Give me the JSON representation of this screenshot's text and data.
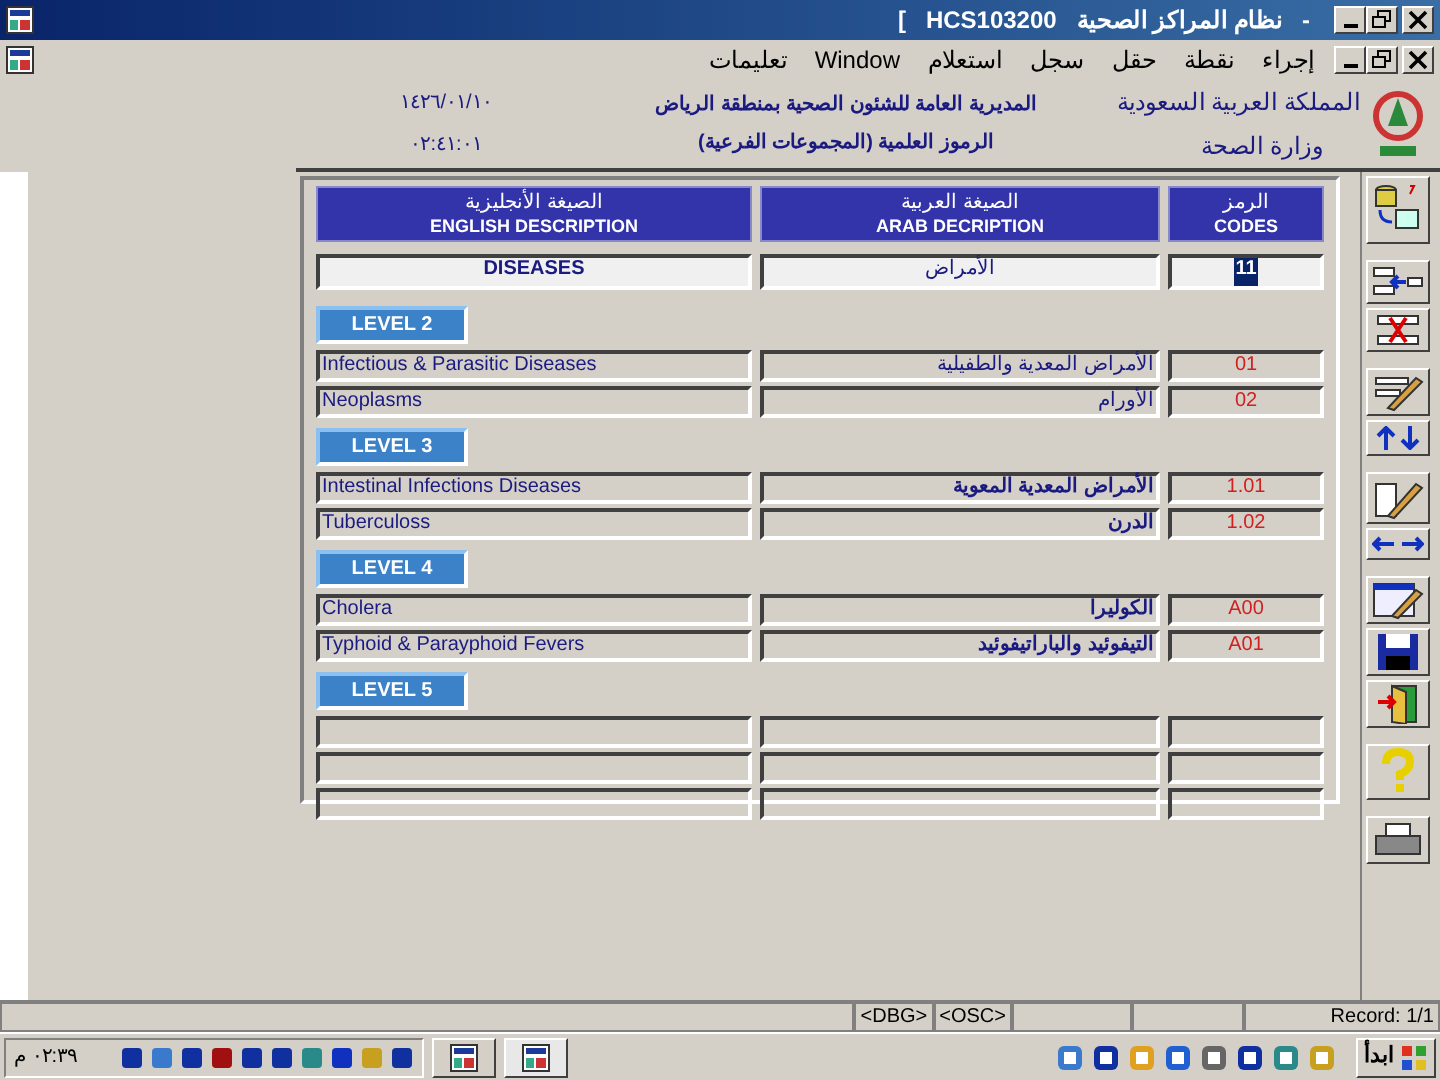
{
  "window": {
    "title_parts": [
      "-",
      "نظام المراكز الصحية",
      "HCS103200",
      "["
    ]
  },
  "menu": [
    "إجراء",
    "نقطة",
    "حقل",
    "سجل",
    "استعلام",
    "Window",
    "تعليمات"
  ],
  "header": {
    "country": "المملكة العربية السعودية",
    "ministry": "وزارة الصحة",
    "directorate": "المديرية العامة للشئون الصحية بمنطقة الرياض",
    "screen_title": "الرموز العلمية (المجموعات الفرعية)",
    "date": "١٤٢٦/٠١/١٠",
    "time": "٠٢:٤١:٠١"
  },
  "table": {
    "columns": [
      {
        "arabic": "الرمز",
        "english": "CODES"
      },
      {
        "arabic": "الصيغة العربية",
        "english": "ARAB DECRIPTION"
      },
      {
        "arabic": "الصيغة الأنجليزية",
        "english": "ENGLISH DESCRIPTION"
      }
    ],
    "top_row": {
      "code": "11",
      "selected": true,
      "arabic": "الأمراض",
      "english": "DISEASES"
    },
    "levels": [
      {
        "label": "LEVEL 2",
        "rows": [
          {
            "kind": "data",
            "code": "01",
            "arabic": "الأمراض المعدية والطفيلية",
            "bold": false,
            "english": "Infectious & Parasitic Diseases"
          },
          {
            "kind": "data",
            "code": "02",
            "arabic": "الأورام",
            "bold": false,
            "english": "Neoplasms"
          }
        ]
      },
      {
        "label": "LEVEL 3",
        "rows": [
          {
            "kind": "data",
            "code": "1.01",
            "arabic": "الأمراض المعدية المعوية",
            "bold": true,
            "english": "Intestinal Infections Diseases"
          },
          {
            "kind": "data",
            "code": "1.02",
            "arabic": "الدرن",
            "bold": true,
            "english": "Tuberculoss"
          }
        ]
      },
      {
        "label": "LEVEL 4",
        "rows": [
          {
            "kind": "data",
            "code": "A00",
            "arabic": "الكوليرا",
            "bold": true,
            "english": "Cholera"
          },
          {
            "kind": "data",
            "code": "A01",
            "arabic": "التيفوئيد والباراتيفوئيد",
            "bold": true,
            "english": "Typhoid & Parayphoid Fevers"
          }
        ]
      },
      {
        "label": "LEVEL 5",
        "rows": [
          {
            "kind": "empty"
          },
          {
            "kind": "empty"
          },
          {
            "kind": "empty"
          }
        ]
      }
    ]
  },
  "status_bar": {
    "record": "Record: 1/1",
    "fields": [
      "<OSC>",
      "<DBG>"
    ]
  },
  "taskbar": {
    "start": "ابدأ",
    "clock": "٠٢:٣٩ م"
  }
}
